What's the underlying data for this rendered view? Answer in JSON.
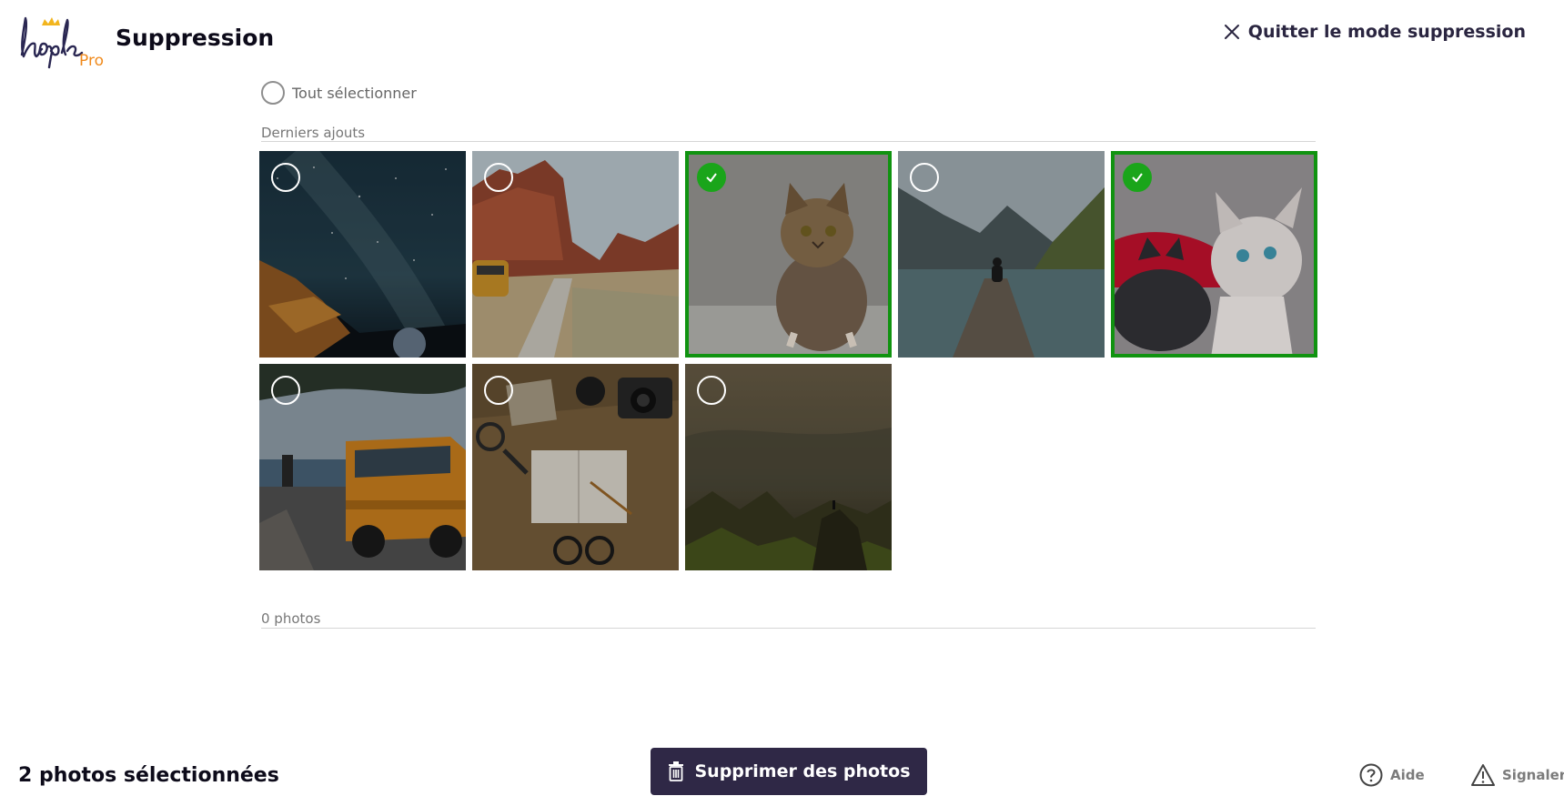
{
  "header": {
    "logo_text": "hopla",
    "logo_badge": "Pro",
    "title": "Suppression",
    "quit_label": "Quitter le mode suppression"
  },
  "select_all": {
    "label": "Tout sélectionner",
    "checked": false
  },
  "sections": [
    {
      "label": "Derniers ajouts",
      "photos": [
        {
          "subject": "starry-sky-tent",
          "selected": false
        },
        {
          "subject": "desert-road-van",
          "selected": false
        },
        {
          "subject": "fluffy-kitten",
          "selected": true
        },
        {
          "subject": "lake-dock-person",
          "selected": false
        },
        {
          "subject": "kittens-on-blanket",
          "selected": true
        },
        {
          "subject": "beach-orange-van",
          "selected": false
        },
        {
          "subject": "travel-desk-notebook",
          "selected": false
        },
        {
          "subject": "misty-mountains",
          "selected": false
        }
      ]
    },
    {
      "label": "0 photos",
      "photos": []
    }
  ],
  "footer": {
    "selection_count": "2 photos sélectionnées",
    "delete_label": "Supprimer des photos",
    "help_label": "Aide",
    "report_label": "Signaler"
  },
  "colors": {
    "primary": "#2f2846",
    "selected_green": "#1aa51a",
    "badge_orange": "#f08a1c"
  },
  "icons": [
    "crown-icon",
    "close-icon",
    "radio-icon",
    "check-icon",
    "trash-icon",
    "help-icon",
    "warning-icon"
  ]
}
